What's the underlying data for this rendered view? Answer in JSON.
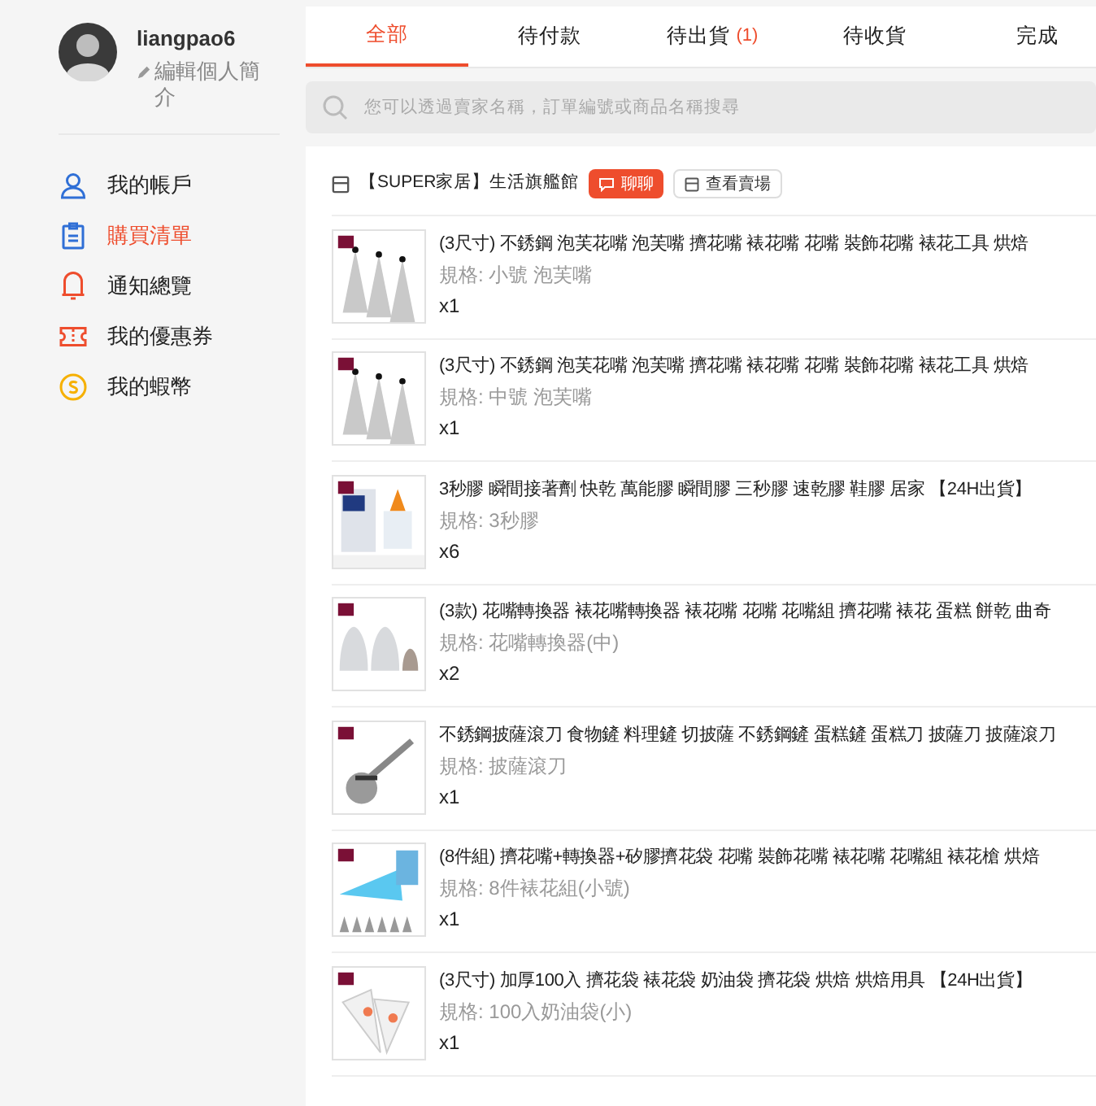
{
  "profile": {
    "username": "liangpao6",
    "edit_label": "編輯個人簡介"
  },
  "sidebar": {
    "items": [
      {
        "label": "我的帳戶",
        "kind": "user",
        "selected": false
      },
      {
        "label": "購買清單",
        "kind": "clipboard",
        "selected": true
      },
      {
        "label": "通知總覽",
        "kind": "bell",
        "selected": false
      },
      {
        "label": "我的優惠券",
        "kind": "ticket",
        "selected": false
      },
      {
        "label": "我的蝦幣",
        "kind": "coin",
        "selected": false
      }
    ]
  },
  "tabs": [
    {
      "label": "全部",
      "selected": true
    },
    {
      "label": "待付款",
      "selected": false
    },
    {
      "label": "待出貨",
      "count": "(1)",
      "selected": false
    },
    {
      "label": "待收貨",
      "selected": false
    },
    {
      "label": "完成",
      "selected": false
    }
  ],
  "search": {
    "placeholder": "您可以透過賣家名稱，訂單編號或商品名稱搜尋"
  },
  "order": {
    "shop_name": "【SUPER家居】生活旗艦館",
    "chat_button": "聊聊",
    "shop_button": "查看賣場",
    "items": [
      {
        "title": "(3尺寸) 不銹鋼 泡芙花嘴 泡芙嘴 擠花嘴 裱花嘴 花嘴 裝飾花嘴 裱花工具 烘焙",
        "variation": "規格: 小號 泡芙嘴",
        "quantity": "x1"
      },
      {
        "title": "(3尺寸) 不銹鋼 泡芙花嘴 泡芙嘴 擠花嘴 裱花嘴 花嘴 裝飾花嘴 裱花工具 烘焙",
        "variation": "規格: 中號 泡芙嘴",
        "quantity": "x1"
      },
      {
        "title": "3秒膠 瞬間接著劑 快乾 萬能膠 瞬間膠 三秒膠 速乾膠 鞋膠 居家 【24H出貨】",
        "variation": "規格: 3秒膠",
        "quantity": "x6"
      },
      {
        "title": "(3款) 花嘴轉換器 裱花嘴轉換器 裱花嘴 花嘴 花嘴組 擠花嘴 裱花 蛋糕 餅乾 曲奇",
        "variation": "規格: 花嘴轉換器(中)",
        "quantity": "x2"
      },
      {
        "title": "不銹鋼披薩滾刀 食物鏟 料理鏟 切披薩 不銹鋼鏟 蛋糕鏟 蛋糕刀 披薩刀 披薩滾刀",
        "variation": "規格: 披薩滾刀",
        "quantity": "x1"
      },
      {
        "title": "(8件組) 擠花嘴+轉換器+矽膠擠花袋 花嘴 裝飾花嘴 裱花嘴 花嘴組 裱花槍 烘焙",
        "variation": "規格: 8件裱花組(小號)",
        "quantity": "x1"
      },
      {
        "title": "(3尺寸) 加厚100入 擠花袋 裱花袋 奶油袋 擠花袋 烘焙 烘焙用具 【24H出貨】",
        "variation": "規格: 100入奶油袋(小)",
        "quantity": "x1"
      }
    ]
  }
}
